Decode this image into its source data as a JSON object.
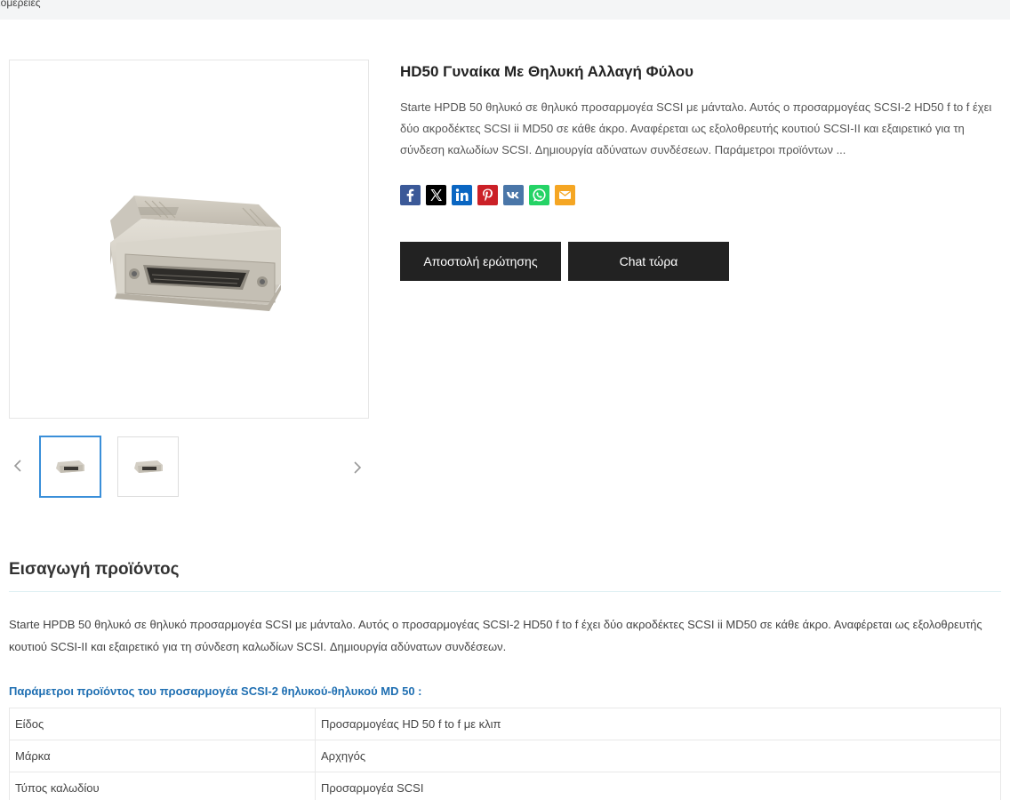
{
  "breadcrumb": {
    "current": "ιομέρειες"
  },
  "product": {
    "title": "HD50 Γυναίκα Με Θηλυκή Αλλαγή Φύλου",
    "summary": "Starte HPDB 50 θηλυκό σε θηλυκό προσαρμογέα SCSI με μάνταλο. Αυτός ο προσαρμογέας SCSI-2 HD50 f to f έχει δύο ακροδέκτες SCSI ii MD50 σε κάθε άκρο. Αναφέρεται ως εξολοθρευτής κουτιού SCSI-II και εξαιρετικό για τη σύνδεση καλωδίων SCSI. Δημιουργία αδύνατων συνδέσεων. Παράμετροι προϊόντων ..."
  },
  "gallery": {
    "main_image": "scsi-adapter-photo",
    "thumbnails": [
      "scsi-adapter-photo-1",
      "scsi-adapter-photo-2"
    ],
    "prev_icon": "chevron-left-icon",
    "next_icon": "chevron-right-icon",
    "active_border_color": "#3a8fd9"
  },
  "share": [
    {
      "name": "facebook-icon",
      "color": "#3b5998"
    },
    {
      "name": "x-icon",
      "color": "#000000"
    },
    {
      "name": "linkedin-icon",
      "color": "#0a66c2"
    },
    {
      "name": "pinterest-icon",
      "color": "#cb2027"
    },
    {
      "name": "vk-icon",
      "color": "#4a76a8"
    },
    {
      "name": "whatsapp-icon",
      "color": "#25d366"
    },
    {
      "name": "email-icon",
      "color": "#f5a623"
    }
  ],
  "actions": {
    "inquiry_label": "Αποστολή ερώτησης",
    "chat_label": "Chat τώρα",
    "button_color": "#222222"
  },
  "introduction": {
    "heading": "Εισαγωγή προϊόντος",
    "text": "Starte HPDB 50 θηλυκό σε θηλυκό προσαρμογέα SCSI με μάνταλο. Αυτός ο προσαρμογέας SCSI-2 HD50 f to f έχει δύο ακροδέκτες SCSI ii MD50 σε κάθε άκρο. Αναφέρεται ως εξολοθρευτής κουτιού SCSI-II και εξαιρετικό για τη σύνδεση καλωδίων SCSI. Δημιουργία αδύνατων συνδέσεων.",
    "params_heading": "Παράμετροι προϊόντος του προσαρμογέα SCSI-2 θηλυκού-θηλυκού MD 50 :",
    "params_heading_color": "#1f6fb2"
  },
  "params": [
    {
      "key": "Είδος",
      "value": "Προσαρμογέας HD 50 f to f με κλιπ"
    },
    {
      "key": "Μάρκα",
      "value": "Αρχηγός"
    },
    {
      "key": "Τύπος καλωδίου",
      "value": "Προσαρμογέα SCSI"
    }
  ]
}
